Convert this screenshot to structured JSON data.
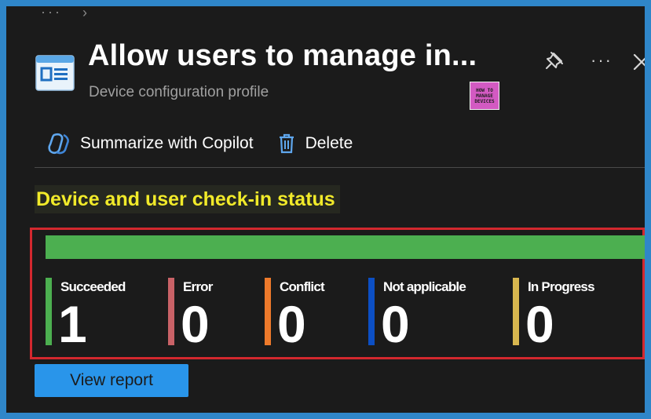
{
  "breadcrumb": {
    "ellipsis": "···",
    "chevron": "›"
  },
  "header": {
    "title": "Allow users to manage in...",
    "subtitle": "Device configuration profile",
    "more_label": "···"
  },
  "logo": {
    "lines": [
      "HOW TO",
      "MANAGE",
      "DEVICES"
    ]
  },
  "toolbar": {
    "copilot_label": "Summarize with Copilot",
    "delete_label": "Delete"
  },
  "section": {
    "heading": "Device and user check-in status"
  },
  "progress": {
    "succeeded_fraction": 1.0
  },
  "stats": [
    {
      "label": "Succeeded",
      "count": "1",
      "color": "#4caf50"
    },
    {
      "label": "Error",
      "count": "0",
      "color": "#c96267"
    },
    {
      "label": "Conflict",
      "count": "0",
      "color": "#ee7a2b"
    },
    {
      "label": "Not applicable",
      "count": "0",
      "color": "#0c4fc4"
    },
    {
      "label": "In Progress",
      "count": "0",
      "color": "#d8b74f"
    }
  ],
  "actions": {
    "view_report_label": "View report"
  },
  "colors": {
    "frame": "#2f86c9",
    "panel": "#1b1b1b",
    "heading_highlight": "#f1ea2a",
    "annotation_border": "#d3282e",
    "primary_button": "#2995ea"
  }
}
